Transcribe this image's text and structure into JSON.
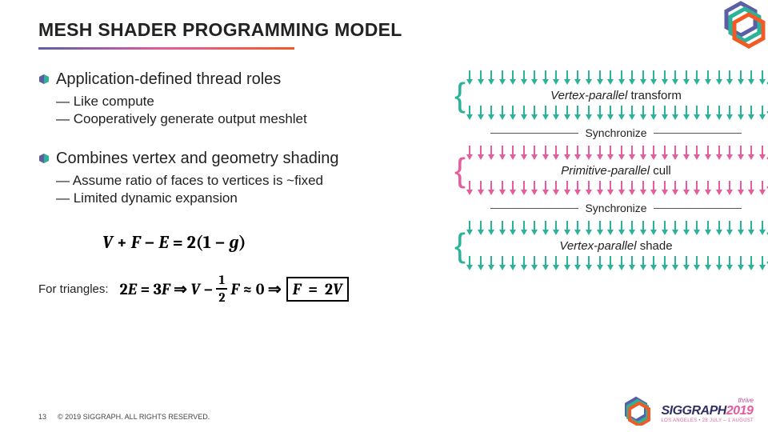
{
  "title": "MESH SHADER PROGRAMMING MODEL",
  "bullets": [
    {
      "text": "Application-defined thread roles",
      "subs": [
        "— Like compute",
        "— Cooperatively generate output meshlet"
      ]
    },
    {
      "text": "Combines vertex and geometry shading",
      "subs": [
        "— Assume ratio of faces to vertices is ~fixed",
        "— Limited dynamic expansion"
      ]
    }
  ],
  "formula1": {
    "lhs_V": "V",
    "plus": "+",
    "F": "F",
    "minus": "−",
    "E": "E",
    "eq": "=",
    "two": "2",
    "lp": "(",
    "one": "1",
    "g": "g",
    "rp": ")"
  },
  "for_triangles_label": "For triangles:",
  "formula2": {
    "_2E": "2",
    "E": "E",
    "eq1": "=",
    "_3F": "3",
    "F1": "F",
    "arrow1": "⇒",
    "V": "V",
    "minus": "−",
    "half_num": "1",
    "half_den": "2",
    "F2": "F",
    "approx": "≈",
    "zero": "0",
    "arrow2": "⇒",
    "boxed_F": "F",
    "boxed_eq": "=",
    "boxed_2V": "2",
    "boxed_V": "V"
  },
  "diagram": {
    "block1_it": "Vertex-parallel",
    "block1_rest": " transform",
    "sync": "Synchronize",
    "block2_it": "Primitive-parallel",
    "block2_rest": " cull",
    "block3_it": "Vertex-parallel",
    "block3_rest": " shade"
  },
  "footer": {
    "page": "13",
    "copyright": "© 2019 SIGGRAPH. ALL RIGHTS RESERVED."
  },
  "siggraph": {
    "thrive": "thrive",
    "main_a": "SIGGRAPH",
    "main_b": "2019",
    "sub": "LOS ANGELES  •  28 JULY – 1 AUGUST"
  },
  "colors": {
    "teal": "#2bb39a",
    "purple": "#5b5ea6",
    "pink": "#e65c9c",
    "orange": "#f15a24"
  }
}
